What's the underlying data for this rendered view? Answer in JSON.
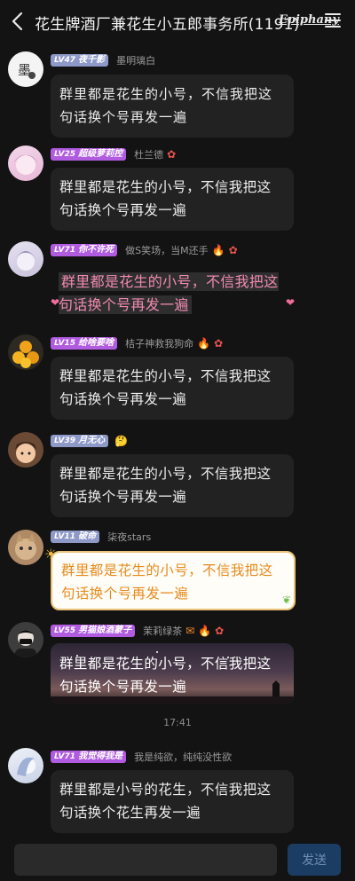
{
  "header": {
    "title": "花生牌酒厂兼花生小五郎事务所(1191)",
    "brand": "Epiphany"
  },
  "colors": {
    "background": "#131313",
    "bubble": "#222222",
    "send_button": "#1c3d63",
    "pink_text": "#f08ab0",
    "orange_text": "#e68a1e"
  },
  "messages": [
    {
      "level": "LV47",
      "badge": "夜千影",
      "nickname": "墨明璃白",
      "text": "群里都是花生的小号，不信我把这句话换个号再发一遍",
      "badge_color": "#8e99c8"
    },
    {
      "level": "LV25",
      "badge": "超级萝莉控",
      "nickname": "杜兰德",
      "text": "群里都是花生的小号，不信我把这句话换个号再发一遍",
      "badge_color": "#b05be0"
    },
    {
      "level": "LV71",
      "badge": "你不许死",
      "nickname": "做S笑场，当M还手",
      "text": "群里都是花生的小号，不信我把这句话换个号再发一遍",
      "badge_color": "#b05be0"
    },
    {
      "level": "LV15",
      "badge": "给啥要啥",
      "nickname": "桔子神救我狗命",
      "text": "群里都是花生的小号，不信我把这句话换个号再发一遍",
      "badge_color": "#b05be0"
    },
    {
      "level": "LV39",
      "badge": "月无心",
      "nickname": "",
      "text": "群里都是花生的小号，不信我把这句话换个号再发一遍",
      "badge_color": "#8e99c8"
    },
    {
      "level": "LV11",
      "badge": "破命",
      "nickname": "柒夜stars",
      "text": "群里都是花生的小号，不信我把这句话换个号再发一遍",
      "badge_color": "#8e99c8"
    },
    {
      "level": "LV55",
      "badge": "男猫娘酒蒙子",
      "nickname": "茉莉绿茶",
      "text": "群里都是花生的小号，不信我把这句话换个号再发一遍",
      "badge_color": "#b05be0"
    },
    {
      "level": "LV71",
      "badge": "我觉得我是",
      "nickname": "我是纯欲，纯纯没性欲",
      "text": "群里都是小号的花生，不信我把这句话换个花生再发一遍",
      "badge_color": "#b05be0"
    }
  ],
  "timestamp": "17:41",
  "input": {
    "placeholder": "",
    "send_label": "发送"
  }
}
